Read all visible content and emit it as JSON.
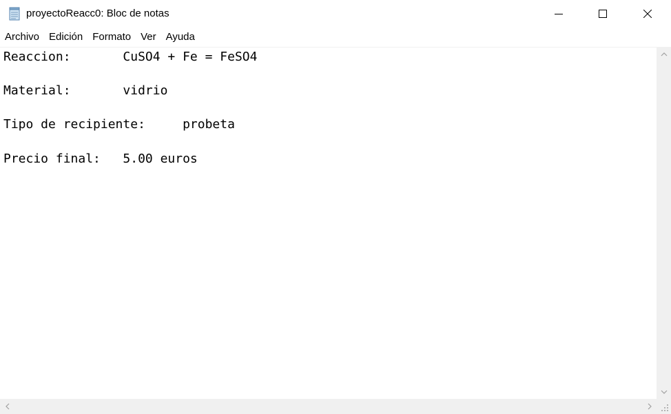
{
  "window": {
    "title": "proyectoReacc0: Bloc de notas",
    "app_icon": "notepad-icon",
    "controls": {
      "minimize_icon": "minimize-icon",
      "maximize_icon": "maximize-icon",
      "close_icon": "close-icon"
    }
  },
  "menubar": {
    "items": [
      {
        "label": "Archivo"
      },
      {
        "label": "Edición"
      },
      {
        "label": "Formato"
      },
      {
        "label": "Ver"
      },
      {
        "label": "Ayuda"
      }
    ]
  },
  "document": {
    "content": "Reaccion:       CuSO4 + Fe = FeSO4\n\nMaterial:       vidrio\n\nTipo de recipiente:     probeta\n\nPrecio final:   5.00 euros"
  },
  "scrollbars": {
    "up_icon": "chevron-up-icon",
    "down_icon": "chevron-down-icon",
    "left_icon": "chevron-left-icon",
    "right_icon": "chevron-right-icon",
    "grip_icon": "size-grip-icon"
  },
  "colors": {
    "background": "#ffffff",
    "scrollbar_track": "#f0f0f0",
    "arrow": "#a0a0a0",
    "text": "#000000"
  }
}
